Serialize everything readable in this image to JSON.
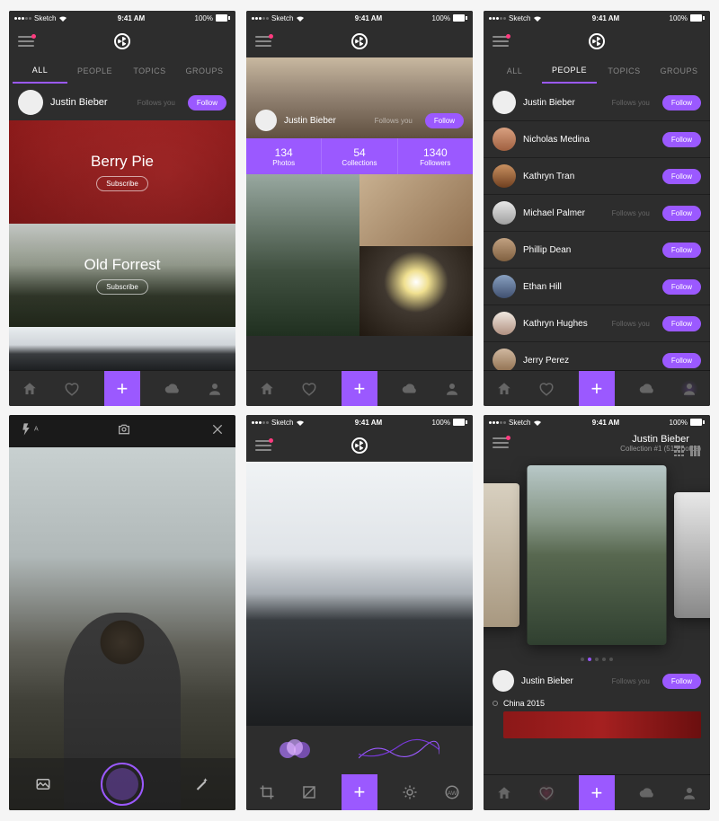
{
  "status": {
    "carrier": "Sketch",
    "time": "9:41 AM",
    "battery": "100%"
  },
  "tabs": [
    "ALL",
    "PEOPLE",
    "TOPICS",
    "GROUPS"
  ],
  "follow": "Follow",
  "follows_you": "Follows you",
  "subscribe": "Subscribe",
  "screen1": {
    "user": "Justin Bieber",
    "cards": [
      {
        "title": "Berry Pie"
      },
      {
        "title": "Old Forrest"
      }
    ]
  },
  "screen2": {
    "user": "Justin Bieber",
    "stats": [
      {
        "num": "134",
        "label": "Photos"
      },
      {
        "num": "54",
        "label": "Collections"
      },
      {
        "num": "1340",
        "label": "Followers"
      }
    ]
  },
  "screen3": {
    "people": [
      {
        "name": "Justin Bieber",
        "follows": true
      },
      {
        "name": "Nicholas Medina",
        "follows": false
      },
      {
        "name": "Kathryn Tran",
        "follows": false
      },
      {
        "name": "Michael Palmer",
        "follows": true
      },
      {
        "name": "Phillip Dean",
        "follows": false
      },
      {
        "name": "Ethan Hill",
        "follows": false
      },
      {
        "name": "Kathryn Hughes",
        "follows": true
      },
      {
        "name": "Jerry Perez",
        "follows": false
      }
    ]
  },
  "screen6": {
    "user": "Justin Bieber",
    "subtitle": "Collection #1 (51 Photos)",
    "timeline": "China 2015"
  },
  "plus": "+"
}
